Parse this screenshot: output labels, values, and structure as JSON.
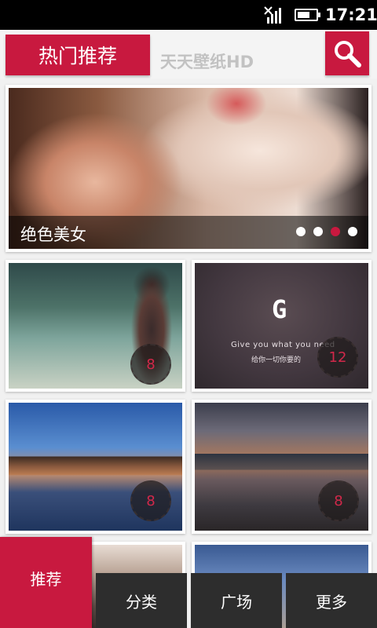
{
  "status_bar": {
    "time": "17:21",
    "signal_icon": "signal-no-service-icon",
    "battery_icon": "battery-icon",
    "battery_level": 0.7
  },
  "header": {
    "title": "热门推荐",
    "app_name": "天天壁纸HD",
    "search_icon": "search-icon",
    "accent_color": "#c8193f"
  },
  "banner": {
    "caption": "绝色美女",
    "page_count": 4,
    "active_page_index": 2
  },
  "tiles": [
    {
      "badge": "8"
    },
    {
      "badge": "12",
      "logo": "G",
      "tagline_en": "Give you what you need",
      "tagline_cn": "给你一切你要的"
    },
    {
      "badge": "8"
    },
    {
      "badge": "8"
    },
    {
      "badge": ""
    },
    {
      "badge": ""
    }
  ],
  "tab_bar": {
    "items": [
      {
        "label": "推荐",
        "active": true
      },
      {
        "label": "分类",
        "active": false
      },
      {
        "label": "广场",
        "active": false
      },
      {
        "label": "更多",
        "active": false
      }
    ]
  }
}
